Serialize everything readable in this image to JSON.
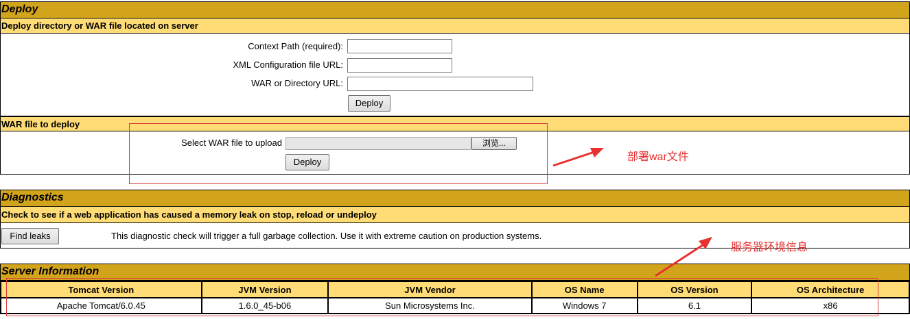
{
  "deploy": {
    "title": "Deploy",
    "dir_section": {
      "title": "Deploy directory or WAR file located on server",
      "context_path_label": "Context Path (required):",
      "context_path_value": "",
      "xml_config_label": "XML Configuration file URL:",
      "xml_config_value": "",
      "war_dir_label": "WAR or Directory URL:",
      "war_dir_value": "",
      "deploy_button": "Deploy"
    },
    "war_section": {
      "title": "WAR file to deploy",
      "select_label": "Select WAR file to upload",
      "browse_button": "浏览...",
      "deploy_button": "Deploy"
    }
  },
  "diagnostics": {
    "title": "Diagnostics",
    "subtitle": "Check to see if a web application has caused a memory leak on stop, reload or undeploy",
    "find_leaks_button": "Find leaks",
    "description": "This diagnostic check will trigger a full garbage collection. Use it with extreme caution on production systems."
  },
  "server_info": {
    "title": "Server Information",
    "headers": [
      "Tomcat Version",
      "JVM Version",
      "JVM Vendor",
      "OS Name",
      "OS Version",
      "OS Architecture"
    ],
    "values": [
      "Apache Tomcat/6.0.45",
      "1.6.0_45-b06",
      "Sun Microsystems Inc.",
      "Windows 7",
      "6.1",
      "x86"
    ]
  },
  "annotations": {
    "deploy_war": "部署war文件",
    "server_env": "服务器环境信息",
    "color": "#e8302f"
  },
  "colors": {
    "section_header": "#D2A41C",
    "subsection_header": "#FFDC75"
  }
}
